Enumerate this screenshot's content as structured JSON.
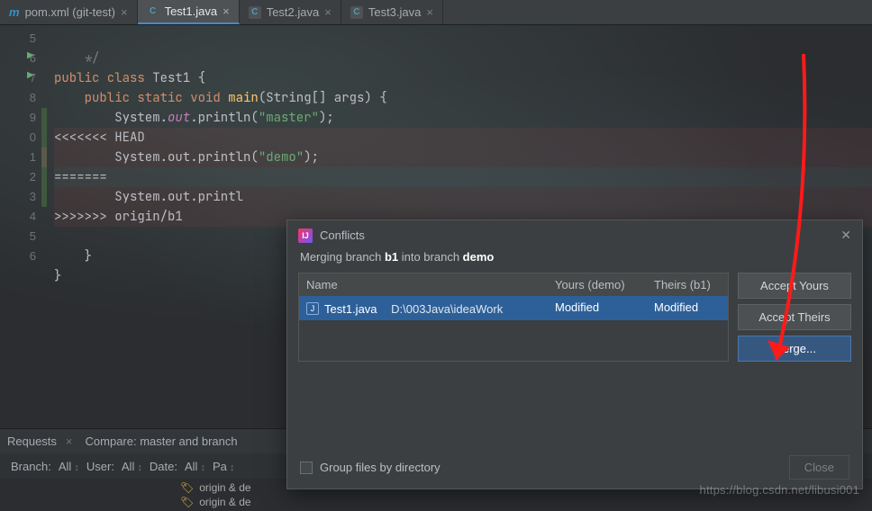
{
  "tabs": [
    {
      "icon": "m",
      "label": "pom.xml (git-test)",
      "active": false
    },
    {
      "icon": "j",
      "label": "Test1.java",
      "active": true
    },
    {
      "icon": "j",
      "label": "Test2.java",
      "active": false
    },
    {
      "icon": "j",
      "label": "Test3.java",
      "active": false
    }
  ],
  "gutter": [
    "5",
    "6",
    "7",
    "8",
    "9",
    "0",
    "1",
    "2",
    "3",
    "4",
    "5",
    "6"
  ],
  "code": {
    "l0": "    */",
    "l1_kw": "public class",
    "l1_name": " Test1 {",
    "l2_kw": "    public static void ",
    "l2_fn": "main",
    "l2_rest": "(String[] args) {",
    "l3_a": "        System.",
    "l3_b": "out",
    "l3_c": ".println(",
    "l3_s": "\"master\"",
    "l3_d": ");",
    "l4": "<<<<<<< HEAD",
    "l5_a": "        System.out.println(",
    "l5_s": "\"demo\"",
    "l5_b": ");",
    "l6": "=======",
    "l7": "        System.out.printl",
    "l8": ">>>>>>> origin/b1",
    "l9": "",
    "l10": "    }",
    "l11": "}"
  },
  "toolstrip": {
    "t1": "Requests",
    "t2": "Compare: master and branch"
  },
  "filterbar": {
    "branch_lbl": "Branch:",
    "branch_val": "All",
    "user_lbl": "User:",
    "user_val": "All",
    "date_lbl": "Date:",
    "date_val": "All",
    "paths": "Pa"
  },
  "refs": {
    "r1": "origin & de",
    "r2": "origin & de"
  },
  "dialog": {
    "title": "Conflicts",
    "sub_pre": "Merging branch ",
    "sub_b1": "b1",
    "sub_mid": " into branch ",
    "sub_b2": "demo",
    "headers": {
      "name": "Name",
      "yours": "Yours (demo)",
      "theirs": "Theirs (b1)"
    },
    "row": {
      "file": "Test1.java",
      "path": "D:\\003Java\\ideaWork",
      "yours": "Modified",
      "theirs": "Modified"
    },
    "btn_ay": "Accept Yours",
    "btn_at": "Accept Theirs",
    "btn_merge": "Merge...",
    "group": "Group files by directory",
    "close": "Close"
  },
  "watermark": "https://blog.csdn.net/libusi001"
}
